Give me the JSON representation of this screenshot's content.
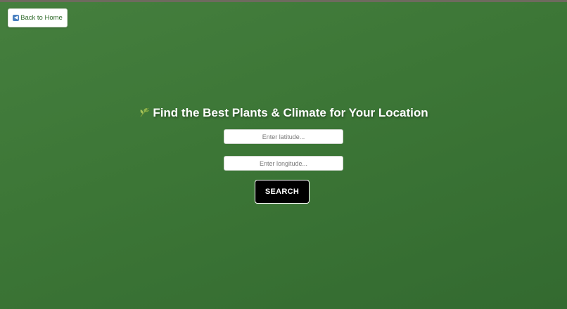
{
  "nav": {
    "back_icon": "back-arrow-icon",
    "back_label": "Back to Home"
  },
  "page": {
    "title_icon": "seedling-icon",
    "title": "Find the Best Plants & Climate for Your Location"
  },
  "form": {
    "latitude_placeholder": "Enter latitude...",
    "latitude_value": "",
    "longitude_placeholder": "Enter longitude...",
    "longitude_value": "",
    "search_label": "SEARCH"
  },
  "colors": {
    "background": "#3c7636",
    "button": "#000000",
    "link_text": "#2f6a2a"
  }
}
